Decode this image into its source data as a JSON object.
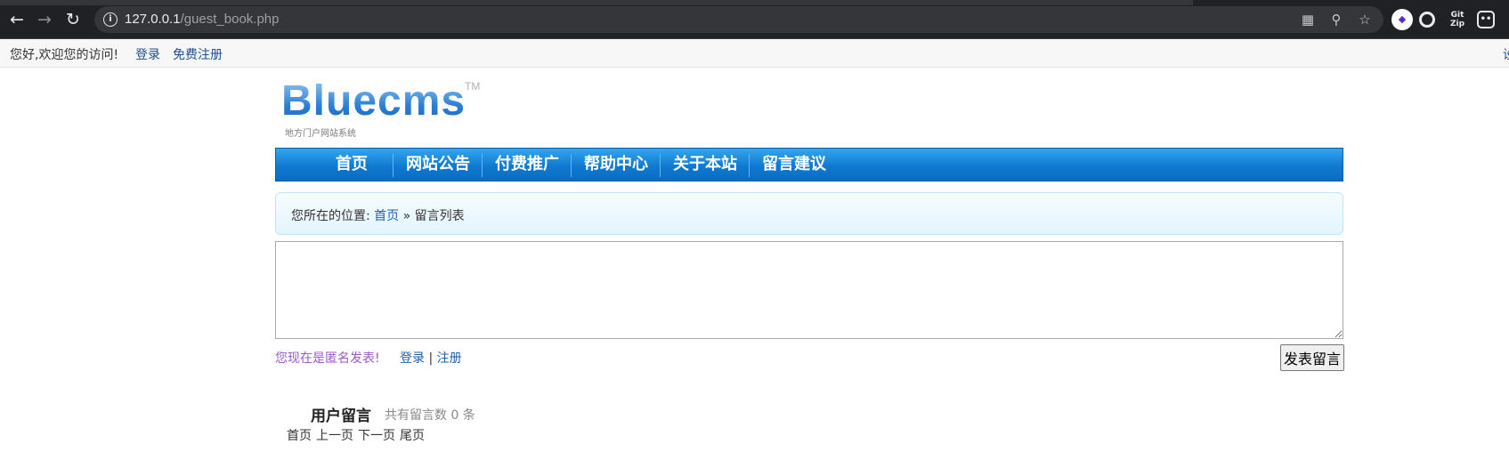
{
  "browser": {
    "url_host": "127.0.0.1",
    "url_path": "/guest_book.php",
    "nav_icons": [
      "back-icon",
      "forward-icon",
      "reload-icon"
    ],
    "toolbar_icons": [
      "qr-code-icon",
      "zoom-icon",
      "bookmark-star-icon"
    ],
    "extension_icons": [
      "extension-purple-icon",
      "extension-circle-icon",
      "gitzip-extension-icon",
      "extension-dice-icon"
    ],
    "gitzip_label": "Git\nZip"
  },
  "topbar": {
    "welcome": "您好,欢迎您的访问!",
    "login": "登录",
    "register": "免费注册",
    "right_cut": "设"
  },
  "logo": {
    "word": "Bluecms",
    "tm": "TM",
    "subtitle": "地方门户网站系统"
  },
  "nav": {
    "items": [
      "首页",
      "网站公告",
      "付费推广",
      "帮助中心",
      "关于本站",
      "留言建议"
    ]
  },
  "breadcrumb": {
    "prefix": "您所在的位置:",
    "home": "首页",
    "sep": "»",
    "current": "留言列表"
  },
  "form": {
    "anon_notice": "您现在是匿名发表!",
    "login": "登录",
    "divider": "|",
    "register": "注册",
    "submit": "发表留言"
  },
  "messages": {
    "title": "用户留言",
    "count_text": "共有留言数 0 条",
    "pager": [
      "首页",
      "上一页",
      "下一页",
      "尾页"
    ]
  }
}
